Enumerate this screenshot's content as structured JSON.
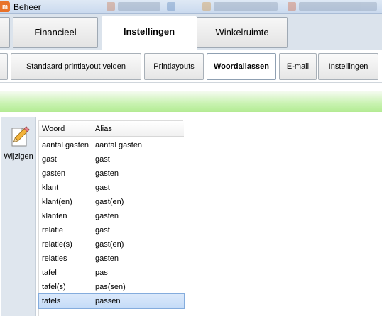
{
  "window": {
    "app_icon_text": "m",
    "title": "Beheer"
  },
  "main_tabs": [
    {
      "label": "Financieel",
      "active": false
    },
    {
      "label": "Instellingen",
      "active": true
    },
    {
      "label": "Winkelruimte",
      "active": false
    }
  ],
  "sub_tabs": [
    {
      "label": "Standaard printlayout velden",
      "active": false
    },
    {
      "label": "Printlayouts",
      "active": false
    },
    {
      "label": "Woordaliassen",
      "active": true
    },
    {
      "label": "E-mail",
      "active": false
    },
    {
      "label": "Instellingen",
      "active": false
    }
  ],
  "sidebar": {
    "edit_button": {
      "label": "Wijzigen",
      "icon": "pencil-document-icon"
    }
  },
  "grid": {
    "columns": [
      "Woord",
      "Alias"
    ],
    "rows": [
      {
        "woord": "aantal gasten",
        "alias": "aantal gasten"
      },
      {
        "woord": "gast",
        "alias": "gast"
      },
      {
        "woord": "gasten",
        "alias": "gasten"
      },
      {
        "woord": "klant",
        "alias": "gast"
      },
      {
        "woord": "klant(en)",
        "alias": "gast(en)"
      },
      {
        "woord": "klanten",
        "alias": "gasten"
      },
      {
        "woord": "relatie",
        "alias": "gast"
      },
      {
        "woord": "relatie(s)",
        "alias": "gast(en)"
      },
      {
        "woord": "relaties",
        "alias": "gasten"
      },
      {
        "woord": "tafel",
        "alias": "pas"
      },
      {
        "woord": "tafel(s)",
        "alias": "pas(sen)"
      },
      {
        "woord": "tafels",
        "alias": "passen"
      }
    ],
    "selected_row_index": 11
  },
  "colors": {
    "accent_green": "#b3eb93",
    "tab_bar_bg": "#dbe3ec",
    "selection": "#c4dbf7"
  }
}
